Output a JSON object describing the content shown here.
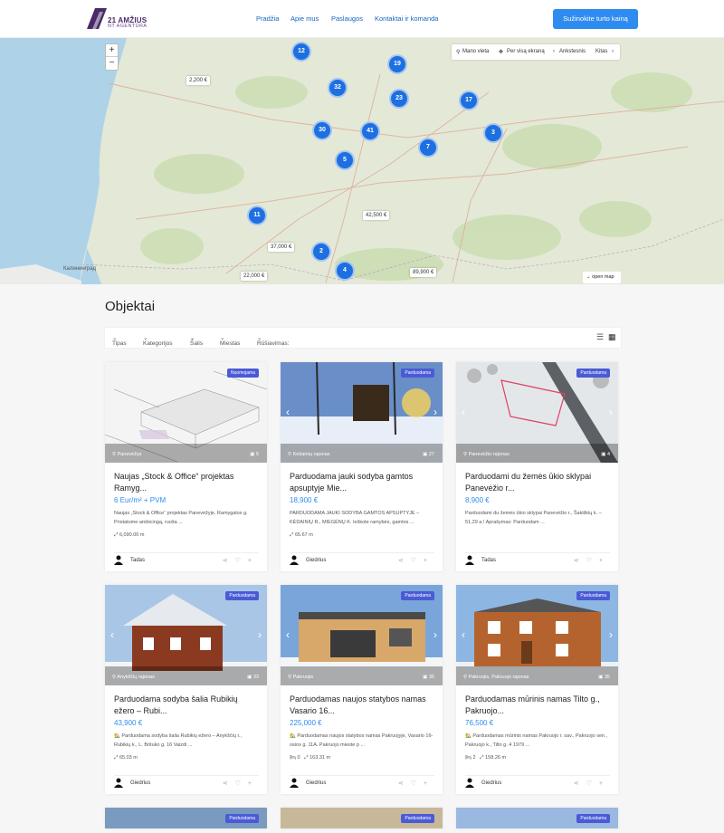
{
  "brand": {
    "name": "21 AMŽIUS",
    "sub": "NT AGENTŪRA"
  },
  "nav": [
    "Pradžia",
    "Apie mus",
    "Paslaugos",
    "Kontaktai ir komanda"
  ],
  "cta": "Sužinokite turto kainą",
  "map": {
    "zoom_in": "+",
    "zoom_out": "−",
    "toolbar": {
      "location": "Mano vieta",
      "fullscreen": "Per visą ekraną",
      "prev": "Ankstesnis",
      "next": "Kitas"
    },
    "clusters": [
      "12",
      "19",
      "32",
      "23",
      "17",
      "30",
      "41",
      "3",
      "7",
      "5",
      "11",
      "2",
      "4"
    ],
    "prices": [
      "2,200 €",
      "42,500 €",
      "37,000 €",
      "22,000 €",
      "89,900 €"
    ],
    "open_map": "open map",
    "labels": {
      "city": "Калининград"
    }
  },
  "section_title": "Objektai",
  "filters": [
    "Tipas",
    "Kategorijos",
    "Šalis",
    "Miestas",
    "Rūšiavimas:"
  ],
  "listings": [
    {
      "badge": "Nuomojama",
      "location": "Panevėžys",
      "photos": "5",
      "title": "Naujas „Stock & Office“ projektas Ramyg...",
      "price": "6 Eur/m² + PVM",
      "desc": "Naujas „Stock & Office“ projektas Panevėžyje, Ramygalos g. Pristatome ambicingą, ruoša ...",
      "meta": "6,090.00 m",
      "agent": "Tadas",
      "img": "warehouse"
    },
    {
      "badge": "Parduodama",
      "location": "Kėdainių rajonas",
      "photos": "27",
      "title": "Parduodama jauki sodyba gamtos apsuptyje Mie...",
      "price": "18,900 €",
      "desc": "PARDUODAMA JAUKI SODYBA GAMTOS APSUPTYJE – KĖDAINIŲ R., MIEGĖNŲ K. Ieškote ramybės, gamtos ...",
      "meta": "65.67 m",
      "agent": "Giedrius",
      "img": "snow"
    },
    {
      "badge": "Parduodama",
      "location": "Panevėžio rajonas",
      "photos": "4",
      "title": "Parduodami du žemės ūkio sklypai Panevėžio r...",
      "price": "8,900 €",
      "desc": "Parduodami du žemės ūkio sklypai Panevėžio r., Šakiškių k. – 51,29 a.! Aprašymas: Parduodam ...",
      "meta": "",
      "agent": "Tadas",
      "img": "aerial"
    },
    {
      "badge": "Parduodama",
      "location": "Anykščių rajonas",
      "photos": "33",
      "title": "Parduodama sodyba šalia Rubikių ežero – Rubi...",
      "price": "43,900 €",
      "desc": "🏡 Parduodama sodyba šalia Rubikių ežero – Anykščių r., Rubikių k., L. Brituko g. 16 Vaizdi ...",
      "meta": "65.03 m",
      "agent": "Giedrius",
      "img": "redhouse"
    },
    {
      "badge": "Parduodama",
      "location": "Pakruojis",
      "photos": "35",
      "title": "Parduodamas naujos statybos namas Vasario 16...",
      "price": "225,000 €",
      "desc": "🏡 Parduodamas naujos statybos namas Pakruojyje, Vasario 16-osios g. 11A. Pakruojo mieste p ...",
      "meta": "163.31 m",
      "beds": "0",
      "agent": "Giedrius",
      "img": "newhouse"
    },
    {
      "badge": "Parduodama",
      "location": "Pakruojis, Pakruojo rajonas",
      "photos": "35",
      "title": "Parduodamas mūrinis namas Tilto g., Pakruojo...",
      "price": "76,500 €",
      "desc": "🏡 Parduodamas mūrinis namas Pakruojo r. sav., Pakruojo sen., Pakruojo k., Tilto g. 4 1979 ...",
      "meta": "158.26 m",
      "beds": "2",
      "agent": "Giedrius",
      "img": "brick"
    }
  ],
  "partial_badges": [
    "Parduodama",
    "Parduodama",
    "Parduodama"
  ]
}
